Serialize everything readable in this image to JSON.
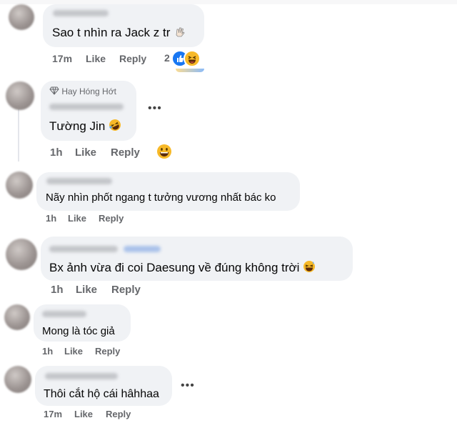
{
  "colors": {
    "bubble": "#f0f2f5",
    "meta_text": "#65676b",
    "like_blue": "#1877f2",
    "haha_yellow": "#f7b928"
  },
  "comments": [
    {
      "text": "Sao t nhìn ra Jack z tr",
      "trailing_emoji": "waving-hand-emoji",
      "time": "17m",
      "like": "Like",
      "reply": "Reply",
      "reaction_count": "2",
      "reaction_icons": [
        "like-reaction-icon",
        "haha-reaction-icon"
      ]
    },
    {
      "badge": "Hay Hóng Hớt",
      "text": "Tường Jin",
      "trailing_emoji": "rolling-laughing-emoji",
      "time": "1h",
      "like": "Like",
      "reply": "Reply",
      "reaction_icons": [
        "grin-emoji-button"
      ]
    },
    {
      "text": "Nãy nhìn phốt ngang t tưởng vương nhất bác ko",
      "time": "1h",
      "like": "Like",
      "reply": "Reply"
    },
    {
      "text": "Bx ảnh vừa đi coi Daesung về đúng không trời",
      "trailing_emoji": "laughing-sweat-emoji",
      "time": "1h",
      "like": "Like",
      "reply": "Reply"
    },
    {
      "text": "Mong là tóc giả",
      "time": "1h",
      "like": "Like",
      "reply": "Reply"
    },
    {
      "text": "Thôi cắt hộ cái hâhhaa",
      "time": "17m",
      "like": "Like",
      "reply": "Reply"
    }
  ]
}
